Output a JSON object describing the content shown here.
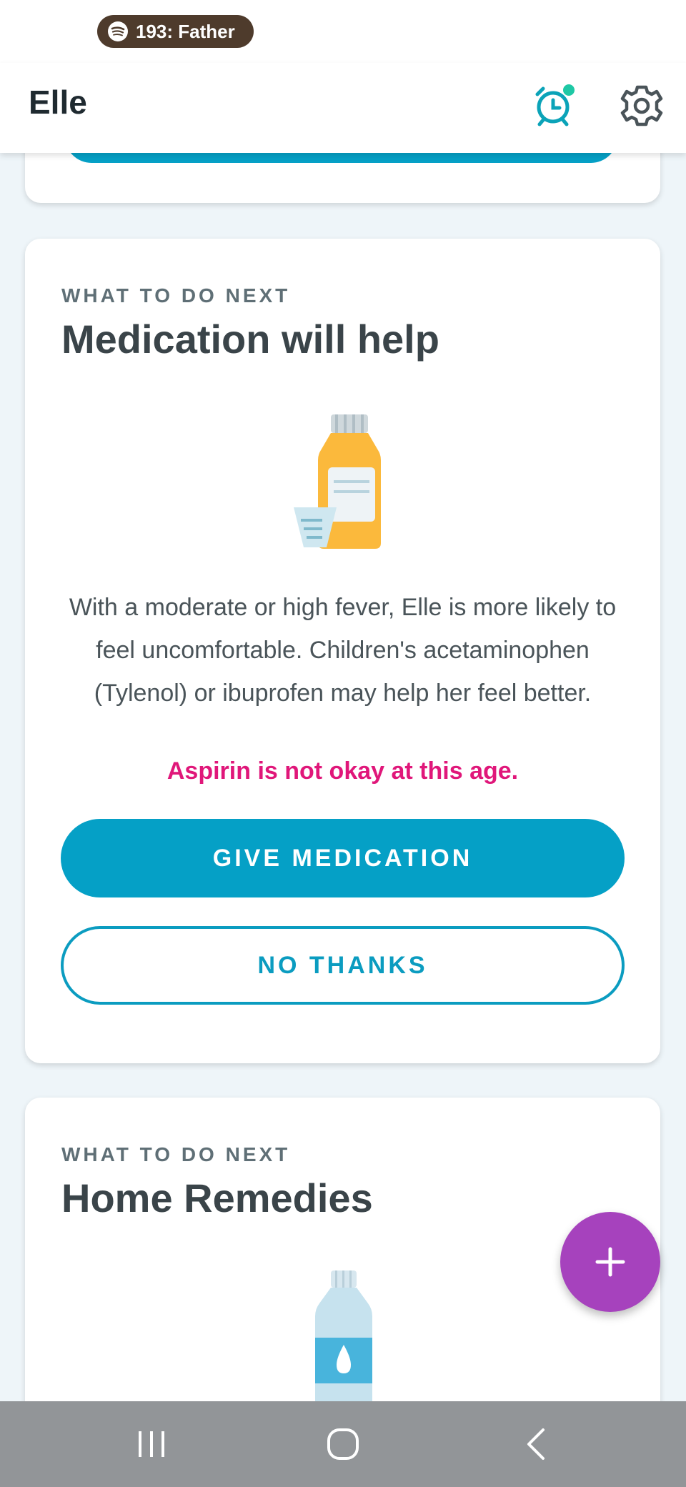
{
  "status_bar": {
    "media_text": "193: Father",
    "media_icon": "spotify-icon"
  },
  "app_bar": {
    "title": "Elle",
    "alarm_icon": "alarm-clock-icon",
    "settings_icon": "gear-icon",
    "alarm_badge_color": "#1ec8a5"
  },
  "cards": {
    "medication": {
      "eyebrow": "WHAT TO DO NEXT",
      "title": "Medication will help",
      "illustration": "medicine-bottle-icon",
      "body": "With a moderate or high fever, Elle is more likely to feel uncomfortable. Children's acetaminophen (Tylenol) or ibuprofen may help her feel better.",
      "warning": "Aspirin is not okay at this age.",
      "primary_button": "GIVE MEDICATION",
      "secondary_button": "NO THANKS"
    },
    "home_remedies": {
      "eyebrow": "WHAT TO DO NEXT",
      "title": "Home Remedies",
      "illustration": "water-bottle-icon"
    }
  },
  "fab": {
    "icon": "plus-icon",
    "color": "#a642bd"
  },
  "nav_bar": {
    "recents_icon": "recents-icon",
    "home_icon": "home-icon",
    "back_icon": "back-icon"
  },
  "colors": {
    "accent": "#05a0c6",
    "warning": "#e0177a",
    "background": "#eef5f9"
  }
}
